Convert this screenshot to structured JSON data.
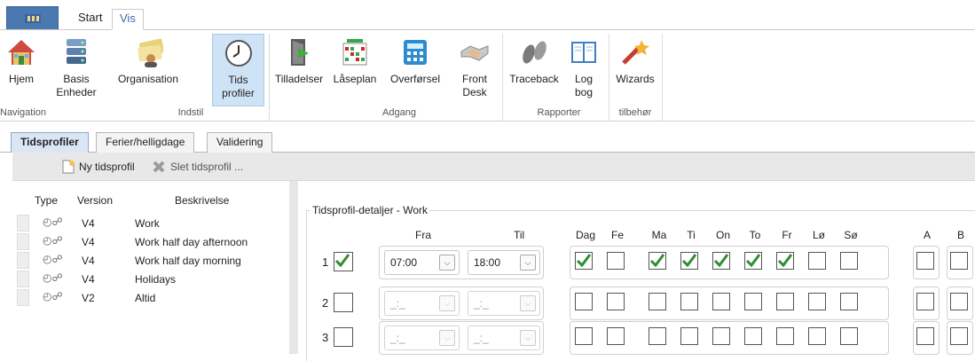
{
  "ribbon_tabs": {
    "file": "",
    "start": "Start",
    "vis": "Vis"
  },
  "ribbon": {
    "buttons": [
      {
        "l1": "Hjem",
        "l2": ""
      },
      {
        "l1": "Basis",
        "l2": "Enheder"
      },
      {
        "l1": "Organisation",
        "l2": ""
      },
      {
        "l1": "Tids",
        "l2": "profiler"
      },
      {
        "l1": "Tilladelser",
        "l2": ""
      },
      {
        "l1": "Låseplan",
        "l2": ""
      },
      {
        "l1": "Overførsel",
        "l2": ""
      },
      {
        "l1": "Front",
        "l2": "Desk"
      },
      {
        "l1": "Traceback",
        "l2": ""
      },
      {
        "l1": "Log",
        "l2": "bog"
      },
      {
        "l1": "Wizards",
        "l2": ""
      }
    ],
    "groups": [
      "Navigation",
      "Indstil",
      "Adgang",
      "Rapporter",
      "tilbehør"
    ]
  },
  "page_tabs": [
    "Tidsprofiler",
    "Ferier/helligdage",
    "Validering"
  ],
  "toolbar": {
    "new": "Ny tidsprofil",
    "delete": "Slet tidsprofil ..."
  },
  "list": {
    "headers": {
      "type": "Type",
      "version": "Version",
      "desc": "Beskrivelse"
    },
    "rows": [
      {
        "version": "V4",
        "desc": "Work"
      },
      {
        "version": "V4",
        "desc": "Work half day afternoon"
      },
      {
        "version": "V4",
        "desc": "Work half day morning"
      },
      {
        "version": "V4",
        "desc": "Holidays"
      },
      {
        "version": "V2",
        "desc": "Altid"
      }
    ]
  },
  "details": {
    "title": "Tidsprofil-detaljer  - Work",
    "col_fra": "Fra",
    "col_til": "Til",
    "days": [
      "Dag",
      "Fe",
      "Ma",
      "Ti",
      "On",
      "To",
      "Fr",
      "Lø",
      "Sø"
    ],
    "extra": [
      "A",
      "B"
    ],
    "rows": [
      {
        "no": "1",
        "enabled": true,
        "fra": "07:00",
        "til": "18:00",
        "checks": [
          true,
          false,
          true,
          true,
          true,
          true,
          true,
          false,
          false
        ]
      },
      {
        "no": "2",
        "enabled": false,
        "fra": "_:_",
        "til": "_:_",
        "checks": [
          false,
          false,
          false,
          false,
          false,
          false,
          false,
          false,
          false
        ]
      },
      {
        "no": "3",
        "enabled": false,
        "fra": "_:_",
        "til": "_:_",
        "checks": [
          false,
          false,
          false,
          false,
          false,
          false,
          false,
          false,
          false
        ]
      }
    ]
  }
}
